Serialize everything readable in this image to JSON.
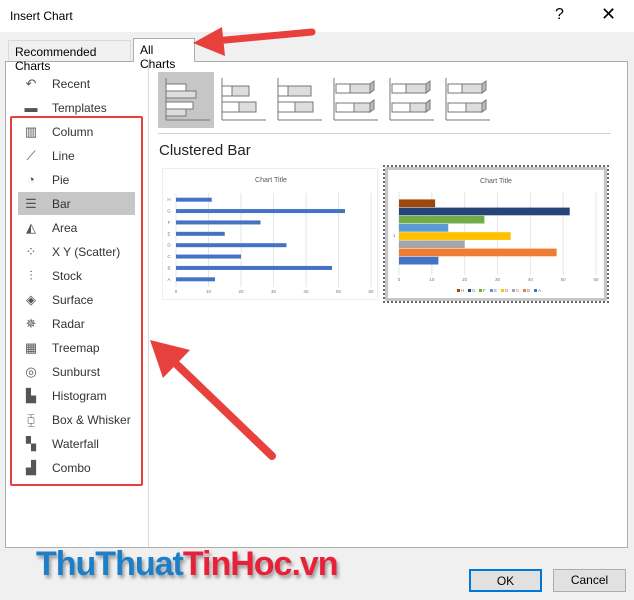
{
  "window": {
    "title": "Insert Chart",
    "help": "?",
    "close": "✕"
  },
  "tabs": [
    {
      "label": "Recommended Charts",
      "selected": false
    },
    {
      "label": "All Charts",
      "selected": true
    }
  ],
  "sidebar": {
    "items": [
      {
        "label": "Recent",
        "icon": "undo-icon",
        "glyph": "↶"
      },
      {
        "label": "Templates",
        "icon": "folder-icon",
        "glyph": "▬"
      },
      {
        "label": "Column",
        "icon": "column-chart-icon",
        "glyph": "▥"
      },
      {
        "label": "Line",
        "icon": "line-chart-icon",
        "glyph": "⟋"
      },
      {
        "label": "Pie",
        "icon": "pie-chart-icon",
        "glyph": "◔"
      },
      {
        "label": "Bar",
        "icon": "bar-chart-icon",
        "glyph": "☰",
        "selected": true
      },
      {
        "label": "Area",
        "icon": "area-chart-icon",
        "glyph": "◭"
      },
      {
        "label": "X Y (Scatter)",
        "icon": "scatter-chart-icon",
        "glyph": "⁘"
      },
      {
        "label": "Stock",
        "icon": "stock-chart-icon",
        "glyph": "⫶"
      },
      {
        "label": "Surface",
        "icon": "surface-chart-icon",
        "glyph": "◈"
      },
      {
        "label": "Radar",
        "icon": "radar-chart-icon",
        "glyph": "✵"
      },
      {
        "label": "Treemap",
        "icon": "treemap-chart-icon",
        "glyph": "▦"
      },
      {
        "label": "Sunburst",
        "icon": "sunburst-chart-icon",
        "glyph": "◎"
      },
      {
        "label": "Histogram",
        "icon": "histogram-chart-icon",
        "glyph": "▙"
      },
      {
        "label": "Box & Whisker",
        "icon": "box-whisker-chart-icon",
        "glyph": "⧮"
      },
      {
        "label": "Waterfall",
        "icon": "waterfall-chart-icon",
        "glyph": "▚"
      },
      {
        "label": "Combo",
        "icon": "combo-chart-icon",
        "glyph": "▟"
      }
    ]
  },
  "subtypes": [
    "clustered-bar",
    "stacked-bar",
    "100-stacked-bar",
    "3d-clustered-bar",
    "3d-stacked-bar",
    "3d-100-stacked-bar"
  ],
  "selected_subtype_title": "Clustered Bar",
  "chart_data": [
    {
      "type": "bar",
      "orientation": "horizontal",
      "title": "Chart Title",
      "categories": [
        "A",
        "B",
        "C",
        "D",
        "E",
        "F",
        "G",
        "H"
      ],
      "values": [
        12,
        48,
        20,
        34,
        15,
        26,
        52,
        11
      ],
      "xlim": [
        0,
        60
      ],
      "ticks": [
        "0",
        "10",
        "20",
        "30",
        "40",
        "50",
        "60"
      ],
      "color": "#4472c4",
      "grid": true
    },
    {
      "type": "bar",
      "orientation": "horizontal",
      "title": "Chart Title",
      "categories": [
        "1"
      ],
      "ticks": [
        "0",
        "10",
        "20",
        "30",
        "40",
        "50",
        "60"
      ],
      "xlim": [
        0,
        60
      ],
      "grid": true,
      "legend": "bottom",
      "series": [
        {
          "name": "A",
          "values": [
            12
          ],
          "color": "#4472c4"
        },
        {
          "name": "B",
          "values": [
            48
          ],
          "color": "#ed7d31"
        },
        {
          "name": "C",
          "values": [
            20
          ],
          "color": "#a5a5a5"
        },
        {
          "name": "D",
          "values": [
            34
          ],
          "color": "#ffc000"
        },
        {
          "name": "E",
          "values": [
            15
          ],
          "color": "#5b9bd5"
        },
        {
          "name": "F",
          "values": [
            26
          ],
          "color": "#70ad47"
        },
        {
          "name": "G",
          "values": [
            52
          ],
          "color": "#264478"
        },
        {
          "name": "H",
          "values": [
            11
          ],
          "color": "#9e480e"
        }
      ]
    }
  ],
  "buttons": {
    "ok": "OK",
    "cancel": "Cancel"
  },
  "watermark": {
    "part1": "ThuThuat",
    "part2": "TinHoc.vn",
    "color1": "#1e7fc7",
    "color2": "#e8213a"
  },
  "annotation_color": "#e8403c"
}
